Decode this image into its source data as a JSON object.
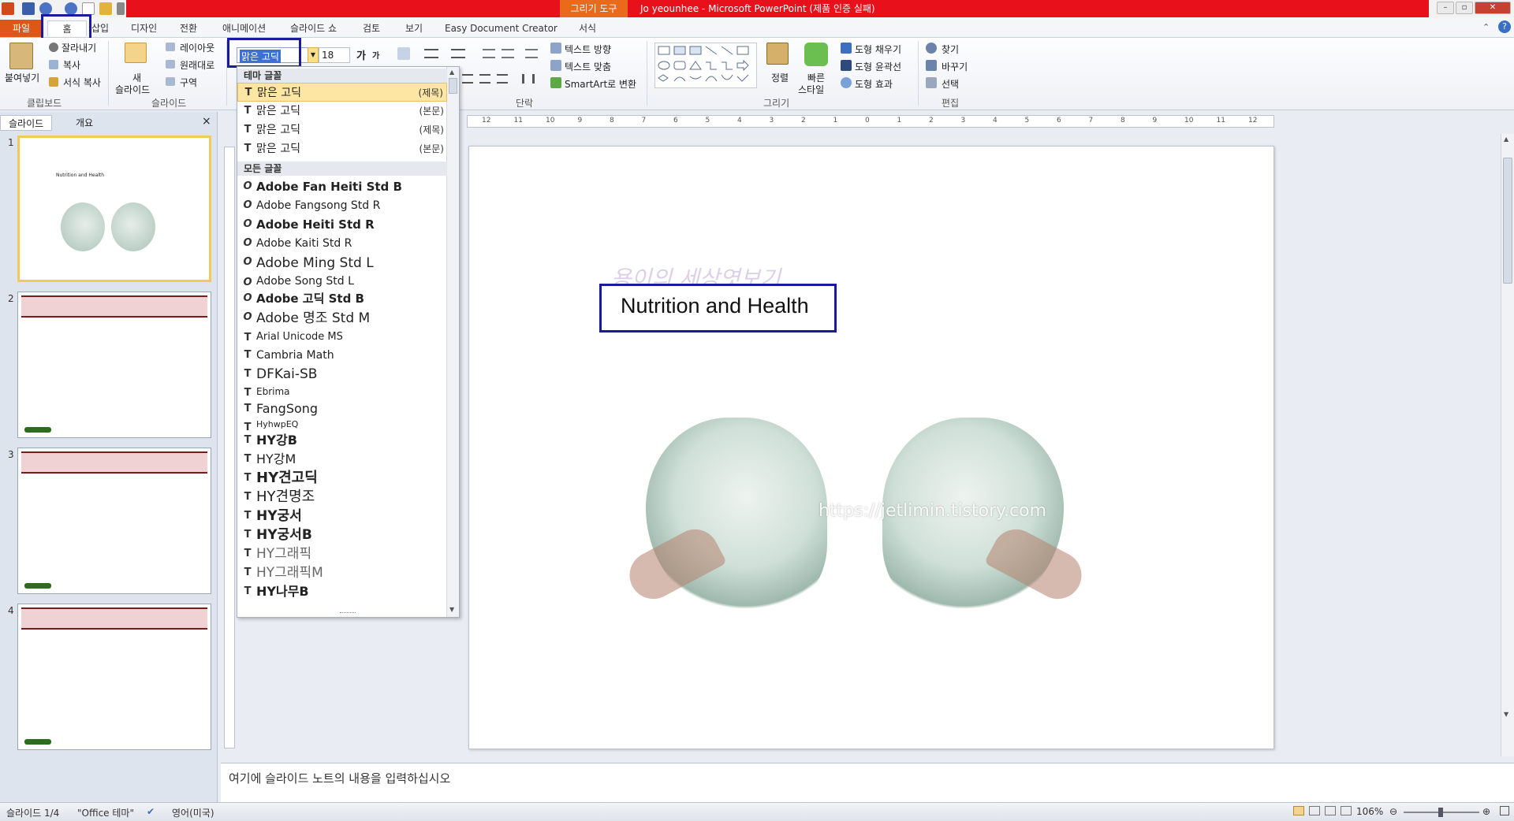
{
  "titlebar": {
    "context_tab": "그리기 도구",
    "title": "Jo yeounhee - Microsoft PowerPoint (제품 인증 실패)"
  },
  "tabs": {
    "file": "파일",
    "home": "홈",
    "insert": "삽입",
    "design": "디자인",
    "transitions": "전환",
    "animations": "애니메이션",
    "slideshow": "슬라이드 쇼",
    "review": "검토",
    "view": "보기",
    "easydoc": "Easy Document Creator",
    "format": "서식"
  },
  "ribbon": {
    "clipboard": {
      "paste": "붙여넣기",
      "cut": "잘라내기",
      "copy": "복사",
      "format_painter": "서식 복사",
      "label": "클립보드"
    },
    "slides": {
      "new_slide_1": "새",
      "new_slide_2": "슬라이드",
      "layout": "레이아웃",
      "reset": "원래대로",
      "section": "구역",
      "label": "슬라이드"
    },
    "font": {
      "name": "맑은 고딕",
      "size": "18"
    },
    "paragraph": {
      "text_direction": "텍스트 방향",
      "align_text": "텍스트 맞춤",
      "smartart": "SmartArt로 변환",
      "label": "단락"
    },
    "drawing": {
      "arrange": "정렬",
      "quick_styles_1": "빠른",
      "quick_styles_2": "스타일",
      "shape_fill": "도형 채우기",
      "shape_outline": "도형 윤곽선",
      "shape_effects": "도형 효과",
      "label": "그리기"
    },
    "editing": {
      "find": "찾기",
      "replace": "바꾸기",
      "select": "선택",
      "label": "편집"
    }
  },
  "font_dropdown": {
    "theme_header": "테마 글꼴",
    "all_header": "모든 글꼴",
    "theme_fonts": [
      {
        "name": "맑은 고딕",
        "tag": "(제목)"
      },
      {
        "name": "맑은 고딕",
        "tag": "(본문)"
      },
      {
        "name": "맑은 고딕",
        "tag": "(제목)"
      },
      {
        "name": "맑은 고딕",
        "tag": "(본문)"
      }
    ],
    "all_fonts": [
      {
        "name": "Adobe Fan Heiti Std B",
        "icon": "O"
      },
      {
        "name": "Adobe Fangsong Std R",
        "icon": "O"
      },
      {
        "name": "Adobe Heiti Std R",
        "icon": "O"
      },
      {
        "name": "Adobe Kaiti Std R",
        "icon": "O"
      },
      {
        "name": "Adobe Ming Std L",
        "icon": "O"
      },
      {
        "name": "Adobe Song Std L",
        "icon": "O"
      },
      {
        "name": "Adobe 고딕 Std B",
        "icon": "O"
      },
      {
        "name": "Adobe 명조 Std M",
        "icon": "O"
      },
      {
        "name": "Arial Unicode MS",
        "icon": "T"
      },
      {
        "name": "Cambria Math",
        "icon": "T"
      },
      {
        "name": "DFKai-SB",
        "icon": "T"
      },
      {
        "name": "Ebrima",
        "icon": "T"
      },
      {
        "name": "FangSong",
        "icon": "T"
      },
      {
        "name": "HyhwpEQ",
        "icon": "T"
      },
      {
        "name": "HY강B",
        "icon": "T"
      },
      {
        "name": "HY강M",
        "icon": "T"
      },
      {
        "name": "HY견고딕",
        "icon": "T"
      },
      {
        "name": "HY견명조",
        "icon": "T"
      },
      {
        "name": "HY궁서",
        "icon": "T"
      },
      {
        "name": "HY궁서B",
        "icon": "T"
      },
      {
        "name": "HY그래픽",
        "icon": "T"
      },
      {
        "name": "HY그래픽M",
        "icon": "T"
      },
      {
        "name": "HY나무B",
        "icon": "T"
      }
    ]
  },
  "left_pane": {
    "tab_slides": "슬라이드",
    "tab_outline": "개요",
    "close": "×",
    "thumbs": [
      {
        "num": "1",
        "title": "Nutrition and Health"
      },
      {
        "num": "2"
      },
      {
        "num": "3"
      },
      {
        "num": "4"
      }
    ]
  },
  "slide": {
    "title": "Nutrition and Health",
    "watermark_top": "용이의 세상엿보기",
    "watermark_url": "https://jetlimin.tistory.com"
  },
  "notes": {
    "placeholder": "여기에 슬라이드 노트의 내용을 입력하십시오"
  },
  "statusbar": {
    "slide_info": "슬라이드 1/4",
    "theme": "\"Office 테마\"",
    "language": "영어(미국)",
    "zoom": "106%"
  }
}
